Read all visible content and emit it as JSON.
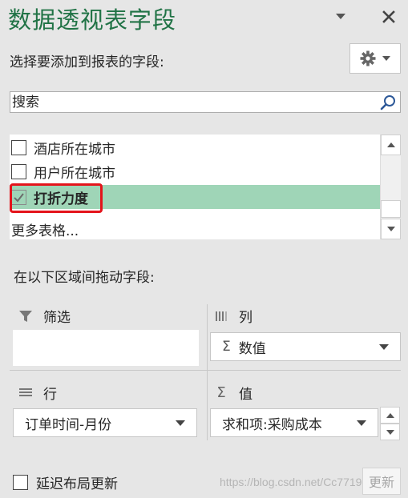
{
  "panel": {
    "title": "数据透视表字段",
    "choose_fields_label": "选择要添加到报表的字段:"
  },
  "search": {
    "placeholder": "搜索"
  },
  "fields": [
    {
      "label": "酒店所在城市",
      "checked": false
    },
    {
      "label": "用户所在城市",
      "checked": false
    },
    {
      "label": "打折力度",
      "checked": true,
      "selected": true
    }
  ],
  "more_tables": "更多表格...",
  "areas": {
    "drag_label": "在以下区域间拖动字段:",
    "filters": {
      "label": "筛选",
      "items": []
    },
    "columns": {
      "label": "列",
      "items": [
        {
          "sigma": "Σ",
          "label": "数值"
        }
      ]
    },
    "rows": {
      "label": "行",
      "items": [
        {
          "label": "订单时间-月份"
        }
      ]
    },
    "values": {
      "label": "值",
      "items": [
        {
          "label": "求和项:采购成本"
        }
      ]
    }
  },
  "footer": {
    "defer_label": "延迟布局更新",
    "update_label": "更新",
    "watermark": "https://blog.csdn.net/Cc7719"
  },
  "colors": {
    "title_green": "#217346",
    "selected_row": "#9fd5b7",
    "highlight_box": "#e4141b",
    "panel_bg": "#e6e6e6"
  },
  "icons": [
    "dropdown-icon",
    "close-icon",
    "gear-icon",
    "search-icon",
    "checkmark-icon",
    "filter-icon",
    "columns-icon",
    "rows-icon",
    "sigma-icon"
  ]
}
